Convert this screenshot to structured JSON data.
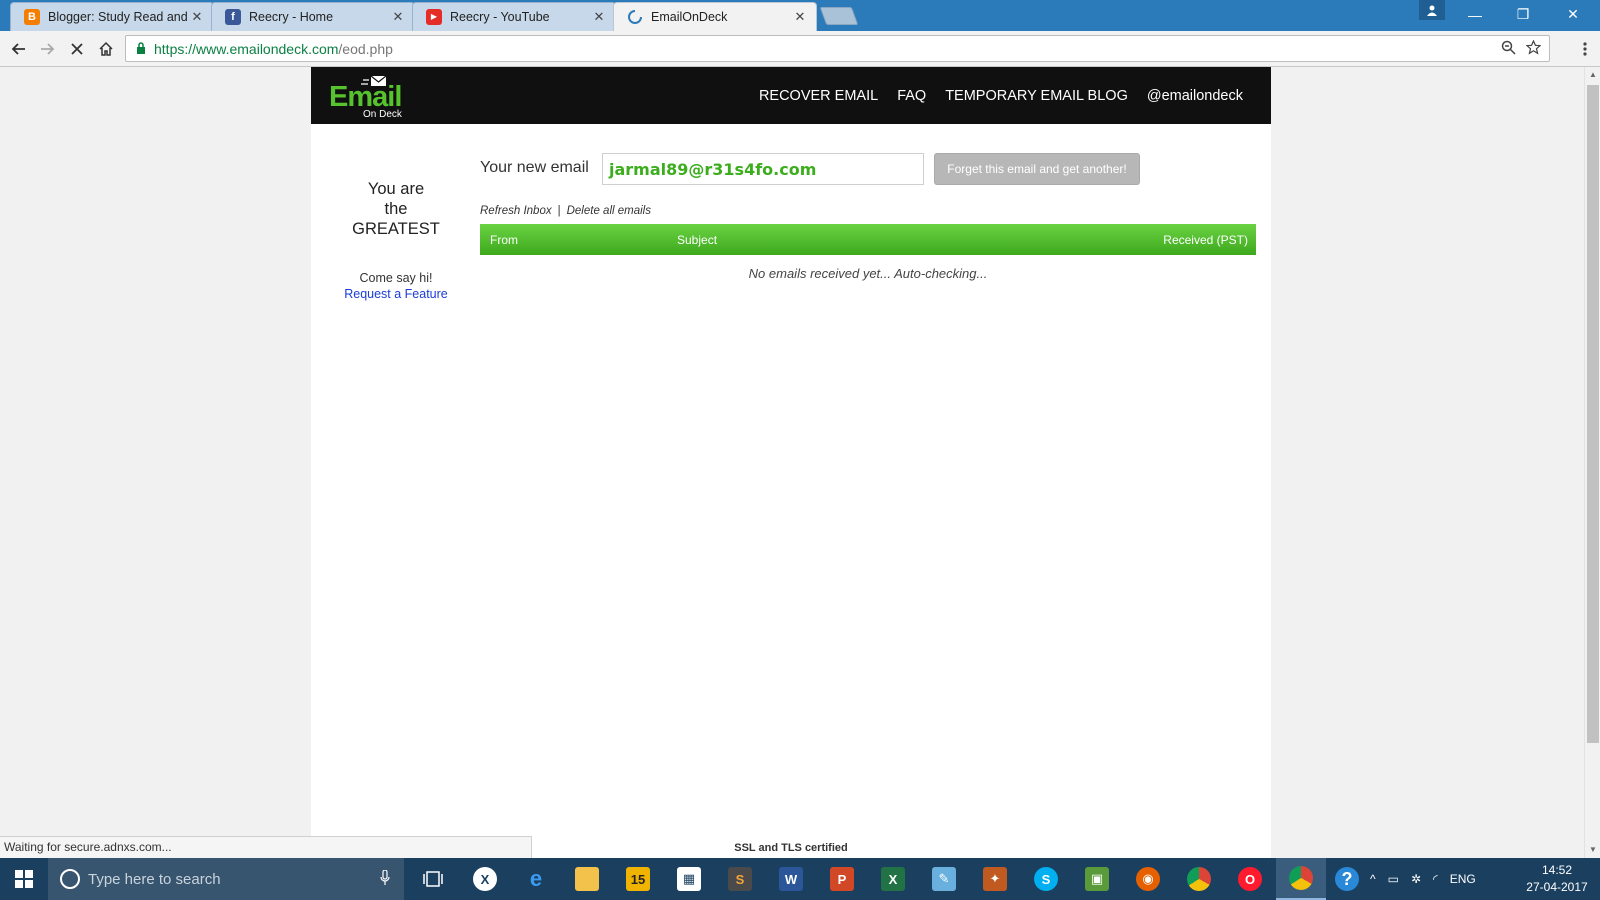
{
  "browser": {
    "tabs": [
      {
        "title": "Blogger: Study Read and",
        "favicon": "blogger-icon",
        "color": "#f57d00",
        "letter": "B"
      },
      {
        "title": "Reecry - Home",
        "favicon": "facebook-icon",
        "color": "#3b5998",
        "letter": "f"
      },
      {
        "title": "Reecry - YouTube",
        "favicon": "youtube-icon",
        "color": "#e52d27",
        "letter": "▶"
      },
      {
        "title": "EmailOnDeck",
        "favicon": "loading-icon",
        "color": "#2b7bba",
        "letter": ""
      }
    ],
    "url_host": "https://www.emailondeck.com",
    "url_path": "/eod.php"
  },
  "site": {
    "logo_main": "Email",
    "logo_sub": "On Deck",
    "nav": [
      "RECOVER EMAIL",
      "FAQ",
      "TEMPORARY EMAIL BLOG",
      "@emailondeck"
    ],
    "sidebar": {
      "line1": "You are",
      "line2": "the",
      "line3": "GREATEST",
      "say_hi": "Come say hi!",
      "request": "Request a Feature"
    },
    "email_label": "Your new email",
    "email_value": "jarmal89@r31s4fo.com",
    "forget_button": "Forget this email and get another!",
    "refresh_link": "Refresh Inbox",
    "delete_link": "Delete all emails",
    "separator": "|",
    "columns": {
      "from": "From",
      "subject": "Subject",
      "received": "Received (PST)"
    },
    "empty_message": "No emails received yet... Auto-checking...",
    "footer": "SSL and TLS certified",
    "accent_color": "#4cbd27"
  },
  "status_bar": "Waiting for secure.adnxs.com...",
  "taskbar": {
    "search_placeholder": "Type here to search",
    "language": "ENG",
    "time": "14:52",
    "date": "27-04-2017"
  }
}
